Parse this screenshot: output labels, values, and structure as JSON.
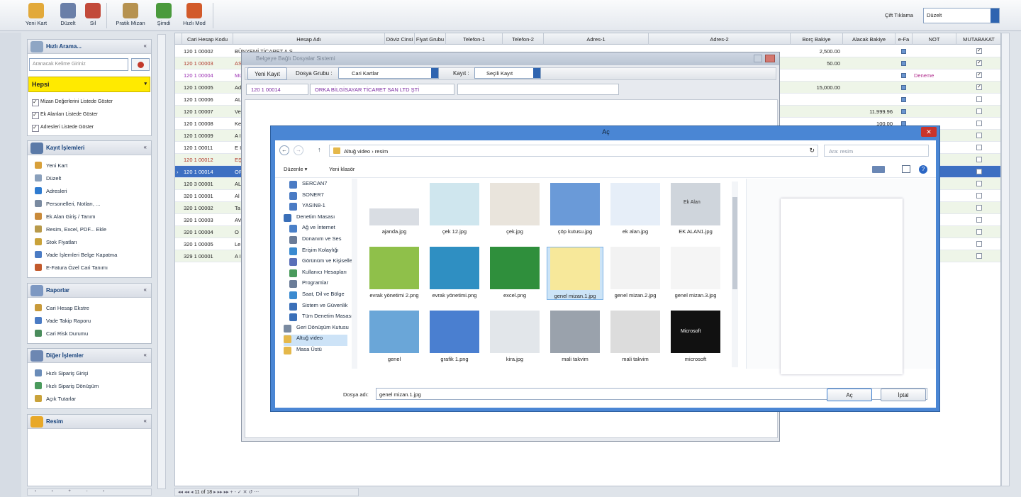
{
  "toolbar": {
    "buttons": [
      {
        "label": "Yeni Kart",
        "color": "#e2a93a"
      },
      {
        "label": "Düzelt",
        "color": "#6a7fa8"
      },
      {
        "label": "Sil",
        "color": "#c24a3a"
      },
      {
        "label": "Pratik Mizan",
        "color": "#b69250"
      },
      {
        "label": "Şimdi",
        "color": "#4a9a3c"
      },
      {
        "label": "Hızlı Mod",
        "color": "#d25a2a"
      }
    ],
    "cift_label": "Çift Tıklama",
    "cift_value": "Düzelt"
  },
  "sidebar": {
    "search_title": "Hızlı Arama...",
    "search_placeholder": "Aranacak Kelime Giriniz",
    "filter_label": "Hepsi",
    "checks": [
      "Mizan Değerlerini Listede Göster",
      "Ek Alanları Listede Göster",
      "Adresleri Listede Göster"
    ],
    "kayit_title": "Kayıt İşlemleri",
    "kayit_items": [
      "Yeni Kart",
      "Düzelt",
      "Adresleri",
      "Personelleri, Notları, ...",
      "Ek Alan Giriş / Tanım",
      "Resim, Excel, PDF... Ekle",
      "Stok Fiyatları",
      "Vade İşlemleri Belge Kapatma",
      "E-Fatura Özel Cari Tanımı"
    ],
    "raporlar_title": "Raporlar",
    "raporlar_items": [
      "Cari Hesap Ekstre",
      "Vade Takip Raporu",
      "Cari Risk Durumu"
    ],
    "diger_title": "Diğer İşlemler",
    "diger_items": [
      "Hızlı Sipariş Girişi",
      "Hızlı Sipariş Dönüşüm",
      "Açık Tutarlar"
    ],
    "resim_title": "Resim"
  },
  "grid": {
    "headers": [
      "Cari Hesap Kodu",
      "Hesap Adı",
      "Döviz Cinsi",
      "Fiyat Grubu",
      "Telefon-1",
      "Telefon-2",
      "Adres-1",
      "Adres-2",
      "Borç Bakiye",
      "Alacak Bakiye",
      "e-Fa",
      "NOT",
      "MUTABAKAT"
    ],
    "rows": [
      {
        "code": "120 1 00002",
        "name": "BÜNYEMİ TİCARET A.Ş.",
        "color": "#222",
        "borc": "2,500.00",
        "alacak": "",
        "note": "",
        "mutabakat": true
      },
      {
        "code": "120 1 00003",
        "name": "AS",
        "color": "#b0392c",
        "borc": "50.00",
        "alacak": "",
        "note": "",
        "mutabakat": true
      },
      {
        "code": "120 1 00004",
        "name": "Mü",
        "color": "#9b2fb3",
        "borc": "",
        "alacak": "",
        "note": "Deneme",
        "mutabakat": true
      },
      {
        "code": "120 1 00005",
        "name": "Ad",
        "color": "#222",
        "borc": "15,000.00",
        "alacak": "",
        "note": "",
        "mutabakat": true
      },
      {
        "code": "120 1 00006",
        "name": "AL",
        "color": "#222",
        "borc": "",
        "alacak": "",
        "note": "",
        "mutabakat": false
      },
      {
        "code": "120 1 00007",
        "name": "Ve",
        "color": "#222",
        "borc": "",
        "alacak": "11,999.96",
        "note": "",
        "mutabakat": false
      },
      {
        "code": "120 1 00008",
        "name": "Ke",
        "color": "#222",
        "borc": "",
        "alacak": "100.00",
        "note": "",
        "mutabakat": false
      },
      {
        "code": "120 1 00009",
        "name": "A I",
        "color": "#222",
        "borc": "",
        "alacak": "",
        "note": "",
        "mutabakat": false
      },
      {
        "code": "120 1 00011",
        "name": "E I",
        "color": "#222",
        "borc": "",
        "alacak": "",
        "note": "",
        "mutabakat": false
      },
      {
        "code": "120 1 00012",
        "name": "EŞ",
        "color": "#b0392c",
        "borc": "",
        "alacak": "",
        "note": "",
        "mutabakat": false
      },
      {
        "code": "120 1 00014",
        "name": "OR",
        "color": "#fff",
        "borc": "",
        "alacak": "",
        "note": "",
        "mutabakat": false,
        "selected": true
      },
      {
        "code": "120 3 00001",
        "name": "AL",
        "color": "#222",
        "borc": "",
        "alacak": "",
        "note": "",
        "mutabakat": false
      },
      {
        "code": "320 1 00001",
        "name": "Al",
        "color": "#222",
        "borc": "",
        "alacak": "",
        "note": "",
        "mutabakat": false
      },
      {
        "code": "320 1 00002",
        "name": "Ta",
        "color": "#222",
        "borc": "",
        "alacak": "",
        "note": "",
        "mutabakat": false
      },
      {
        "code": "320 1 00003",
        "name": "AV",
        "color": "#222",
        "borc": "",
        "alacak": "",
        "note": "",
        "mutabakat": false
      },
      {
        "code": "320 1 00004",
        "name": "O",
        "color": "#222",
        "borc": "",
        "alacak": "",
        "note": "",
        "mutabakat": false
      },
      {
        "code": "320 1 00005",
        "name": "Le",
        "color": "#222",
        "borc": "",
        "alacak": "",
        "note": "",
        "mutabakat": false
      },
      {
        "code": "329 1 00001",
        "name": "A I",
        "color": "#222",
        "borc": "",
        "alacak": "",
        "note": "",
        "mutabakat": false
      }
    ],
    "pager": "11 of 18"
  },
  "bgdialog": {
    "title": "Belgeye Bağlı Dosyalar Sistemi",
    "yeni_kayit": "Yeni Kayıt",
    "dosya_grubu_label": "Dosya Grubu :",
    "dosya_grubu_value": "Cari Kartlar",
    "kayit_label": "Kayıt :",
    "kayit_value": "Seçili Kayıt",
    "code": "120 1 00014",
    "name": "ORKA BİLGİSAYAR TİCARET SAN LTD ŞTİ"
  },
  "opendlg": {
    "title": "Aç",
    "path": [
      "Altuğ video",
      "resim"
    ],
    "search_placeholder": "Ara: resim",
    "duzenle": "Düzenle",
    "yeni_klasor": "Yeni klasör",
    "tree": [
      {
        "label": "SERCAN7",
        "indent": 1,
        "color": "#4a7bc4"
      },
      {
        "label": "SONER7",
        "indent": 1,
        "color": "#4a7bc4"
      },
      {
        "label": "YASIN8-1",
        "indent": 1,
        "color": "#4a7bc4"
      },
      {
        "label": "Denetim Masası",
        "indent": 0,
        "color": "#3a6fb8"
      },
      {
        "label": "Ağ ve İnternet",
        "indent": 1,
        "color": "#4a80c8"
      },
      {
        "label": "Donanım ve Ses",
        "indent": 1,
        "color": "#6a7c98"
      },
      {
        "label": "Erişim Kolaylığı",
        "indent": 1,
        "color": "#3a8ad0"
      },
      {
        "label": "Görünüm ve Kişiselleştirme",
        "indent": 1,
        "color": "#5a6fb8"
      },
      {
        "label": "Kullanıcı Hesapları",
        "indent": 1,
        "color": "#4a9a5c"
      },
      {
        "label": "Programlar",
        "indent": 1,
        "color": "#6a7c98"
      },
      {
        "label": "Saat, Dil ve Bölge",
        "indent": 1,
        "color": "#3a8ad0"
      },
      {
        "label": "Sistem ve Güvenlik",
        "indent": 1,
        "color": "#3a6fb8"
      },
      {
        "label": "Tüm Denetim Masası",
        "indent": 1,
        "color": "#3a6fb8"
      },
      {
        "label": "Geri Dönüşüm Kutusu",
        "indent": 0,
        "color": "#7a8aa0"
      },
      {
        "label": "Altuğ video",
        "indent": 0,
        "color": "#e5b84a",
        "selected": true
      },
      {
        "label": "Masa Üstü",
        "indent": 0,
        "color": "#e5b84a"
      }
    ],
    "files": [
      {
        "name": "ajanda.jpg",
        "kind": "ajanda"
      },
      {
        "name": "çek 12.jpg",
        "kind": "cek12"
      },
      {
        "name": "çek.jpg",
        "kind": "cek"
      },
      {
        "name": "çöp kutusu.jpg",
        "kind": "cop"
      },
      {
        "name": "ek alan.jpg",
        "kind": "ekalan"
      },
      {
        "name": "EK ALAN1.jpg",
        "kind": "ekalan1"
      },
      {
        "name": "evrak yönetimi 2.png",
        "kind": "evrak2"
      },
      {
        "name": "evrak yönetimi.png",
        "kind": "evrak"
      },
      {
        "name": "excel.png",
        "kind": "excel"
      },
      {
        "name": "genel mizan.1.jpg",
        "kind": "mizan1",
        "selected": true
      },
      {
        "name": "genel mizan.2.jpg",
        "kind": "mizan2"
      },
      {
        "name": "genel mizan.3.jpg",
        "kind": "mizan3"
      },
      {
        "name": "genel",
        "kind": "genel"
      },
      {
        "name": "grafik 1.png",
        "kind": "grafik"
      },
      {
        "name": "kira.jpg",
        "kind": "kira"
      },
      {
        "name": "mali takvim",
        "kind": "takvim1"
      },
      {
        "name": "mali takvim",
        "kind": "takvim2"
      },
      {
        "name": "microsoft",
        "kind": "microsoft"
      }
    ],
    "thumb_labels": {
      "ek_alan": "Ek Alan",
      "microsoft": "Microsoft"
    },
    "dosya_adi_label": "Dosya adı:",
    "dosya_adi_value": "genel mizan.1.jpg",
    "ac": "Aç",
    "iptal": "İptal"
  }
}
